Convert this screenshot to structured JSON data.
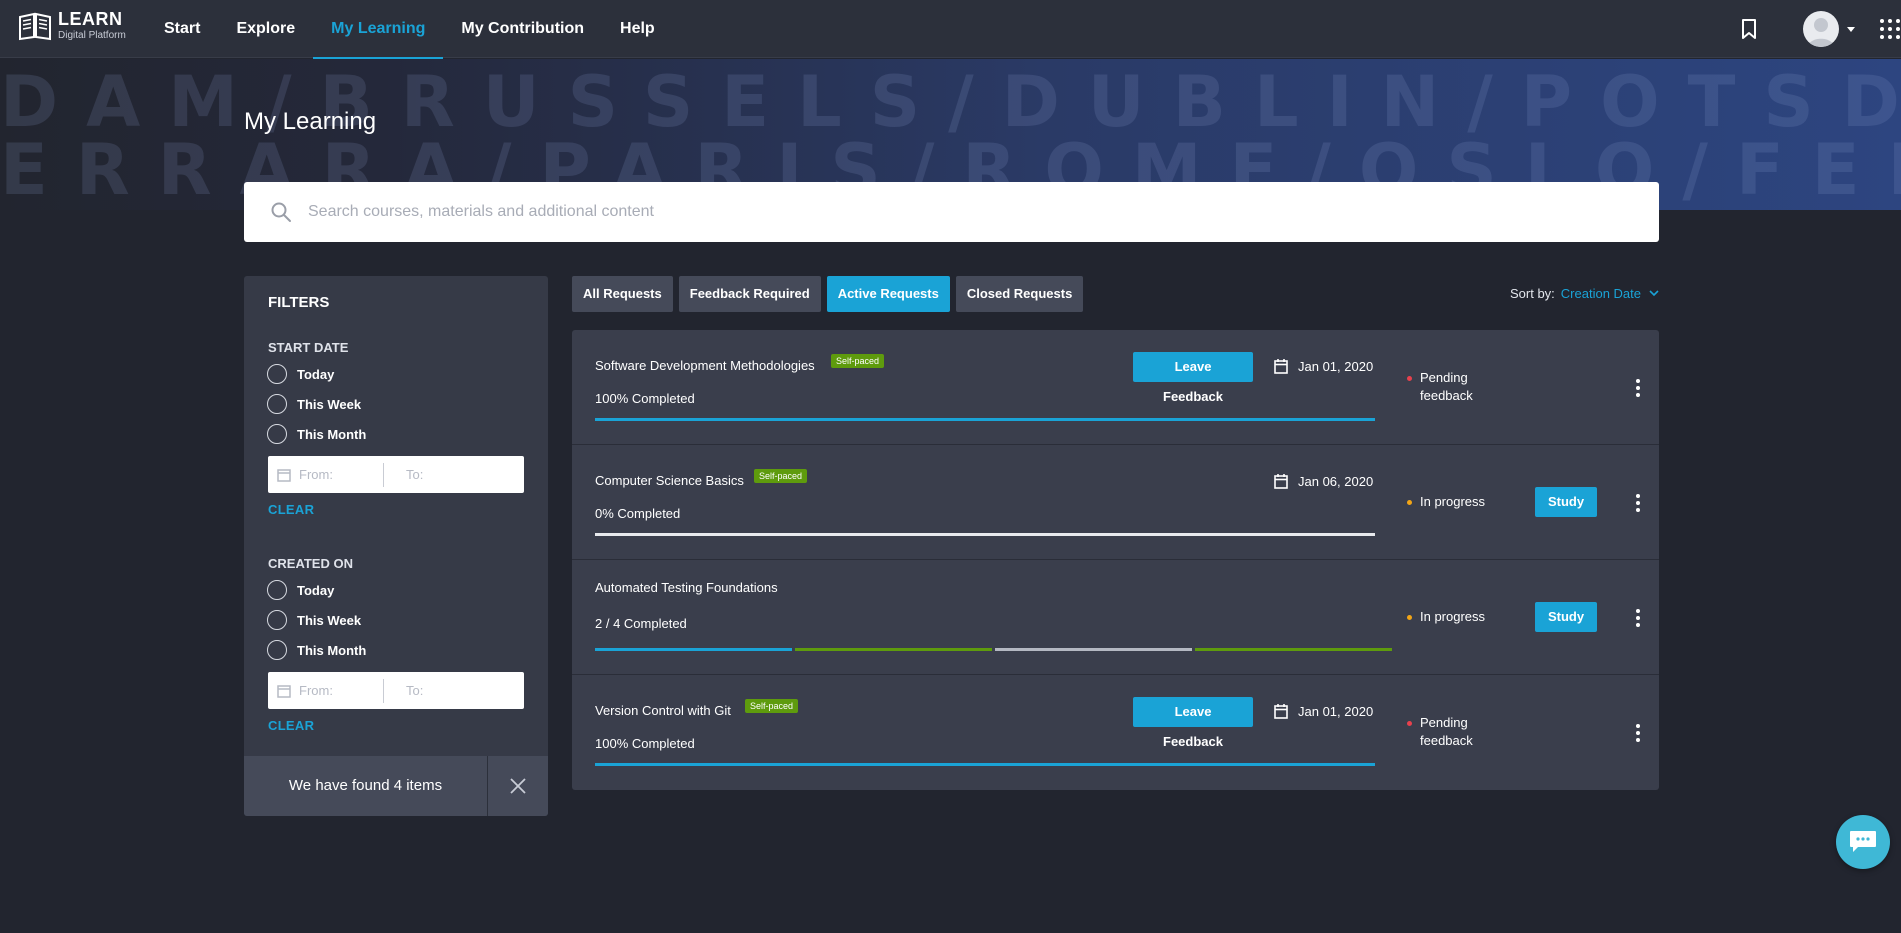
{
  "header": {
    "logo_title": "LEARN",
    "logo_subtitle": "Digital Platform",
    "nav": [
      {
        "label": "Start"
      },
      {
        "label": "Explore"
      },
      {
        "label": "My Learning"
      },
      {
        "label": "My Contribution"
      },
      {
        "label": "Help"
      }
    ],
    "active_nav": "My Learning",
    "icons": [
      "bookmark-icon",
      "avatar",
      "apps-grid-icon"
    ]
  },
  "banner": {
    "row1": "DAM/BRUSSELS/DUBLIN/POTSDAM/BRUSSELS/",
    "row2": "ERRARA/PARIS/ROME/OSLO/FERRARA/PARIS/",
    "page_title": "My Learning"
  },
  "search": {
    "placeholder": "Search courses, materials and additional content"
  },
  "filters": {
    "title": "FILTERS",
    "start_date": {
      "title": "START DATE",
      "options": [
        "Today",
        "This Week",
        "This Month"
      ],
      "from_placeholder": "From:",
      "to_placeholder": "To:",
      "clear": "CLEAR"
    },
    "created_on": {
      "title": "CREATED ON",
      "options": [
        "Today",
        "This Week",
        "This Month"
      ],
      "from_placeholder": "From:",
      "to_placeholder": "To:",
      "clear": "CLEAR"
    },
    "found_text": "We have found 4 items"
  },
  "tabs": [
    {
      "label": "All Requests",
      "active": false
    },
    {
      "label": "Feedback Required",
      "active": false
    },
    {
      "label": "Active Requests",
      "active": true
    },
    {
      "label": "Closed Requests",
      "active": false
    }
  ],
  "sort": {
    "label": "Sort by:",
    "value": "Creation Date"
  },
  "colors": {
    "accent": "#1aa3d6",
    "badge": "#5e9b0d",
    "status_pending": "#e8414d",
    "status_in_progress": "#f2a516"
  },
  "courses": [
    {
      "title": "Software Development Methodologies",
      "badge": "Self-paced",
      "progress_text": "100% Completed",
      "progress_fraction": 1.0,
      "action": "Leave Feedback",
      "date": "Jan 01, 2020",
      "status": "Pending feedback",
      "status_color": "#e8414d"
    },
    {
      "title": "Computer Science Basics",
      "badge": "Self-paced",
      "progress_text": "0% Completed",
      "progress_fraction": 0.0,
      "action": "Study",
      "date": "Jan 06, 2020",
      "status": "In progress",
      "status_color": "#f2a516"
    },
    {
      "title": "Automated Testing Foundations",
      "badge": "",
      "progress_text": "2 / 4 Completed",
      "segments": [
        "#1aa3d6",
        "#5e9b0d",
        "#b4b8c2",
        "#5e9b0d"
      ],
      "action": "Study",
      "date": "",
      "status": "In progress",
      "status_color": "#f2a516"
    },
    {
      "title": "Version Control with Git",
      "badge": "Self-paced",
      "progress_text": "100% Completed",
      "progress_fraction": 1.0,
      "action": "Leave Feedback",
      "date": "Jan 01, 2020",
      "status": "Pending feedback",
      "status_color": "#e8414d"
    }
  ]
}
